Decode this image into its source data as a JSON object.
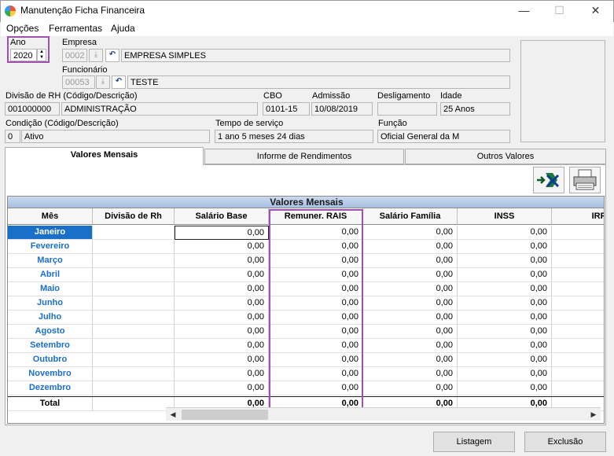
{
  "window": {
    "title": "Manutenção Ficha Financeira",
    "controls": {
      "minimize": "—",
      "maximize": "☐",
      "close": "✕"
    }
  },
  "menu": [
    {
      "label": "Opções"
    },
    {
      "label": "Ferramentas"
    },
    {
      "label": "Ajuda"
    }
  ],
  "ano": {
    "label": "Ano",
    "value": "2020"
  },
  "empresa": {
    "label": "Empresa",
    "code": "0002",
    "name": "EMPRESA SIMPLES"
  },
  "funcionario": {
    "label": "Funcionário",
    "code": "00053",
    "name": "TESTE"
  },
  "divisao": {
    "label": "Divisão de RH (Código/Descrição)",
    "code": "001000000",
    "name": "ADMINISTRAÇÃO"
  },
  "cbo": {
    "label": "CBO",
    "value": "0101-15"
  },
  "admissao": {
    "label": "Admissão",
    "value": "10/08/2019"
  },
  "desligamento": {
    "label": "Desligamento",
    "value": ""
  },
  "idade": {
    "label": "Idade",
    "value": "25 Anos"
  },
  "condicao": {
    "label": "Condição (Código/Descrição)",
    "code": "0",
    "name": "Ativo"
  },
  "tempo": {
    "label": "Tempo de serviço",
    "value": "1 ano 5 meses 24 dias"
  },
  "funcao": {
    "label": "Função",
    "value": "Oficial General da M"
  },
  "tabs": [
    {
      "label": "Valores Mensais"
    },
    {
      "label": "Informe de Rendimentos"
    },
    {
      "label": "Outros Valores"
    }
  ],
  "grid": {
    "title": "Valores Mensais",
    "columns": [
      "Mês",
      "Divisão de Rh",
      "Salário Base",
      "Remuner. RAIS",
      "Salário Família",
      "INSS",
      "IRF"
    ],
    "rows": [
      {
        "mes": "Janeiro",
        "div": "",
        "sal": "0,00",
        "rais": "0,00",
        "fam": "0,00",
        "inss": "0,00"
      },
      {
        "mes": "Fevereiro",
        "div": "",
        "sal": "0,00",
        "rais": "0,00",
        "fam": "0,00",
        "inss": "0,00"
      },
      {
        "mes": "Março",
        "div": "",
        "sal": "0,00",
        "rais": "0,00",
        "fam": "0,00",
        "inss": "0,00"
      },
      {
        "mes": "Abril",
        "div": "",
        "sal": "0,00",
        "rais": "0,00",
        "fam": "0,00",
        "inss": "0,00"
      },
      {
        "mes": "Maio",
        "div": "",
        "sal": "0,00",
        "rais": "0,00",
        "fam": "0,00",
        "inss": "0,00"
      },
      {
        "mes": "Junho",
        "div": "",
        "sal": "0,00",
        "rais": "0,00",
        "fam": "0,00",
        "inss": "0,00"
      },
      {
        "mes": "Julho",
        "div": "",
        "sal": "0,00",
        "rais": "0,00",
        "fam": "0,00",
        "inss": "0,00"
      },
      {
        "mes": "Agosto",
        "div": "",
        "sal": "0,00",
        "rais": "0,00",
        "fam": "0,00",
        "inss": "0,00"
      },
      {
        "mes": "Setembro",
        "div": "",
        "sal": "0,00",
        "rais": "0,00",
        "fam": "0,00",
        "inss": "0,00"
      },
      {
        "mes": "Outubro",
        "div": "",
        "sal": "0,00",
        "rais": "0,00",
        "fam": "0,00",
        "inss": "0,00"
      },
      {
        "mes": "Novembro",
        "div": "",
        "sal": "0,00",
        "rais": "0,00",
        "fam": "0,00",
        "inss": "0,00"
      },
      {
        "mes": "Dezembro",
        "div": "",
        "sal": "0,00",
        "rais": "0,00",
        "fam": "0,00",
        "inss": "0,00"
      }
    ],
    "total": {
      "label": "Total",
      "sal": "0,00",
      "rais": "0,00",
      "fam": "0,00",
      "inss": "0,00"
    }
  },
  "buttons": {
    "listagem": "Listagem",
    "exclusao": "Exclusão"
  },
  "icons": {
    "export": "excel-export-icon",
    "print": "printer-icon"
  },
  "colors": {
    "accent": "#1a6fc9",
    "highlight": "#a050b0"
  }
}
